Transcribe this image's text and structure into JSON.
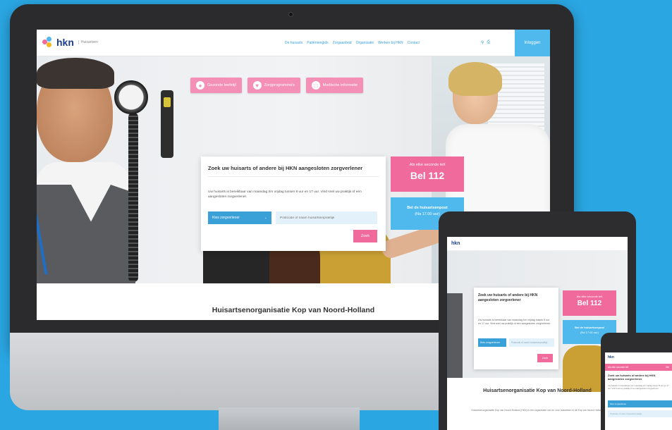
{
  "site": {
    "logo_text": "hkn",
    "logo_sub": "Huisartsen",
    "login_label": "Inloggen"
  },
  "nav": {
    "items": [
      "De huisarts",
      "Patiëntengids",
      "Zorgaanbod",
      "Organisatie",
      "Werken bij HKN",
      "Contact"
    ],
    "icons": [
      "search-icon",
      "print-icon"
    ]
  },
  "tabs": [
    {
      "label": "Gezonde leefstijl",
      "icon": "apple-icon"
    },
    {
      "label": "Zorgprogramma's",
      "icon": "heart-icon"
    },
    {
      "label": "Medische informatie",
      "icon": "document-icon"
    }
  ],
  "search": {
    "title": "Zoek uw huisarts of andere bij HKN aangesloten zorgverlener",
    "description": "Uw huisarts is bereikbaar van maandag t/m vrijdag tussen 8 uur en 17 uur. Vind snel uw praktijk of een aangesloten zorgverlener.",
    "select_label": "Kies zorgverlener",
    "placeholder": "Postcode of naam huisartsenpraktijk",
    "button": "Zoek"
  },
  "emergency": {
    "subtitle": "Als elke seconde telt",
    "number": "Bel 112"
  },
  "post": {
    "title": "Bel de huisartsenpost",
    "subtitle": "(Na 17.00 uur)"
  },
  "org_title": "Huisartsenorganisatie Kop van Noord-Holland",
  "tablet": {
    "org_title": "Huisartsenorganisatie Kop van Noord-Holland",
    "body": "Huisartsenorganisatie Kop van Noord-Holland (HKN) is een organisatie van en voor huisartsen in de Kop van Noord-Holland."
  },
  "phone": {
    "emergency": "Als elke seconde telt",
    "emergency_short": "Bel"
  },
  "colors": {
    "background": "#2aa6e2",
    "pink": "#f06a9c",
    "blue": "#4fb8ec",
    "brand": "#1b3e8a"
  }
}
